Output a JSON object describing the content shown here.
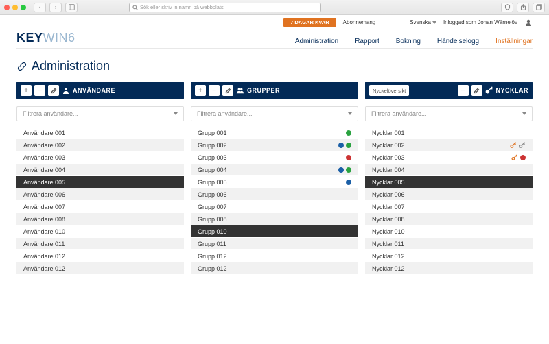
{
  "chrome": {
    "search_placeholder": "Sök eller skriv in namn på webbplats"
  },
  "top": {
    "banner": "7 DAGAR KVAR",
    "subscription": "Abonnemang",
    "language": "Svenska",
    "login_text": "Inloggad som Johan Wärnelöv"
  },
  "logo": {
    "a": "KEY",
    "b": "WIN",
    "c": "6"
  },
  "nav": {
    "administration": "Administration",
    "rapport": "Rapport",
    "bokning": "Bokning",
    "handelselogg": "Händelselogg",
    "installningar": "Inställningar"
  },
  "page_title": "Administration",
  "panel_labels": {
    "users": "ANVÄNDARE",
    "groups": "GRUPPER",
    "keys": "NYCKLAR",
    "key_overview": "Nyckelöversikt"
  },
  "filter_placeholder": "Filtrera användare...",
  "users": [
    {
      "name": "Användare 001"
    },
    {
      "name": "Användare 002"
    },
    {
      "name": "Användare 003"
    },
    {
      "name": "Användare 004"
    },
    {
      "name": "Användare 005",
      "selected": true
    },
    {
      "name": "Användare 006"
    },
    {
      "name": "Användare 007"
    },
    {
      "name": "Användare 008"
    },
    {
      "name": "Användare 010"
    },
    {
      "name": "Användare 011"
    },
    {
      "name": "Användare 012"
    },
    {
      "name": "Användare 012"
    }
  ],
  "groups": [
    {
      "name": "Grupp 001",
      "status": [
        "g"
      ]
    },
    {
      "name": "Grupp 002",
      "status": [
        "b",
        "g"
      ]
    },
    {
      "name": "Grupp 003",
      "status": [
        "r"
      ]
    },
    {
      "name": "Grupp 004",
      "status": [
        "b",
        "g"
      ]
    },
    {
      "name": "Grupp 005",
      "status": [
        "b"
      ]
    },
    {
      "name": "Grupp 006"
    },
    {
      "name": "Grupp 007"
    },
    {
      "name": "Grupp 008"
    },
    {
      "name": "Grupp 010",
      "selected": true
    },
    {
      "name": "Grupp 011"
    },
    {
      "name": "Grupp 012"
    },
    {
      "name": "Grupp 012"
    }
  ],
  "keys": [
    {
      "name": "Nycklar 001"
    },
    {
      "name": "Nycklar 002",
      "icons": [
        "o",
        "g"
      ]
    },
    {
      "name": "Nycklar 003",
      "icons": [
        "o",
        "r-dot"
      ]
    },
    {
      "name": "Nycklar 004"
    },
    {
      "name": "Nycklar 005",
      "selected": true
    },
    {
      "name": "Nycklar 006"
    },
    {
      "name": "Nycklar 007"
    },
    {
      "name": "Nycklar 008"
    },
    {
      "name": "Nycklar 010"
    },
    {
      "name": "Nycklar 011"
    },
    {
      "name": "Nycklar 012"
    },
    {
      "name": "Nycklar 012"
    }
  ]
}
